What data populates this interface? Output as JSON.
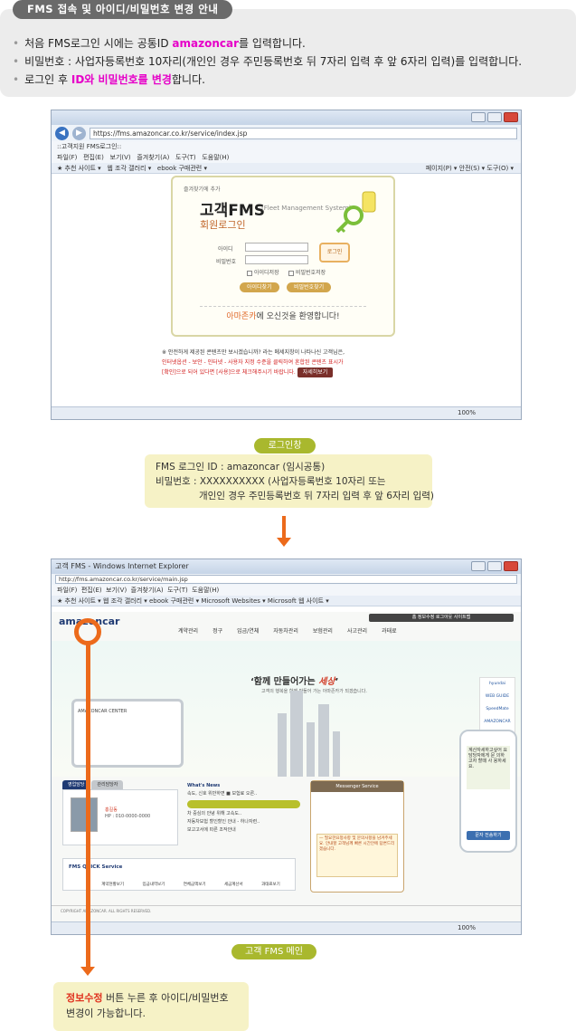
{
  "header": {
    "title": "FMS 접속 및 아이디/비밀번호 변경 안내",
    "bullets": [
      {
        "before": "처음 FMS로그인 시에는 공통ID ",
        "highlight": "amazoncar",
        "after": "를 입력합니다."
      },
      {
        "before": "비밀번호 : 사업자등록번호 10자리(개인인 경우 주민등록번호 뒤 7자리 입력 후 앞 6자리 입력)를 입력합니다.",
        "highlight": "",
        "after": ""
      },
      {
        "before": "로그인 후 ",
        "highlight": "ID와 비밀번호를 변경",
        "after": "합니다."
      }
    ]
  },
  "login_screen": {
    "url": "https://fms.amazoncar.co.kr/service/index.jsp",
    "tab_title": "::고객지원 FMS로그인::",
    "menu_items": [
      "파일(F)",
      "편집(E)",
      "보기(V)",
      "즐겨찾기(A)",
      "도구(T)",
      "도움말(H)"
    ],
    "fav_items": [
      "추천 사이트",
      "웹 조각 갤러리",
      "ebook 구매관련"
    ],
    "right_tools": "페이지(P) ▾  안전(S) ▾  도구(O) ▾",
    "card": {
      "fav": "즐겨찾기에 추가",
      "title": "고객FMS",
      "subtitle": "(Fleet Management System)",
      "login_label": "회원로그인",
      "id_label": "아이디",
      "pw_label": "비밀번호",
      "login_button": "로그인",
      "save_id": "아이디저장",
      "save_pw": "비밀번호저장",
      "find_id": "아이디찾기",
      "find_pw": "비밀번호찾기",
      "welcome_brand": "아마존카",
      "welcome_rest": "에 오신것을 환영합니다!"
    },
    "notice": {
      "line1": "※ 안전하게 제공된 콘텐츠만 보시겠습니까? 라는 메세지창이 나타나신 고객님은,",
      "line2": "인터넷옵션 - 보안 - 인터넷 - 사용자 지정 수준을 클릭하여 혼합된 콘텐츠 표시가",
      "line3": "[확인]으로 되어 있다면 [사용]으로 체크해주시기 바랍니다.",
      "detail_button": "자세히보기"
    },
    "zoom": "100%"
  },
  "login_label": "로그인창",
  "credentials": {
    "line1": "FMS 로그인 ID : amazoncar (임시공통)",
    "line2": "비밀번호 : XXXXXXXXXX (사업자등록번호 10자리 또는",
    "line3": "개인인 경우 주민등록번호 뒤 7자리 입력 후 앞 6자리 입력)"
  },
  "main_screen": {
    "title_bar": "고객 FMS - Windows Internet Explorer",
    "url": "http://fms.amazoncar.co.kr/service/main.jsp",
    "menu_items": [
      "파일(F)",
      "편집(E)",
      "보기(V)",
      "즐겨찾기(A)",
      "도구(T)",
      "도움말(H)"
    ],
    "fav_items": [
      "추천 사이트",
      "웹 조각 갤러리",
      "ebook 구매관련",
      "Microsoft Websites",
      "Microsoft 웹 사이트"
    ],
    "brand": "amazoncar",
    "top_links": "홈  정보수정  로그아웃  사이트맵",
    "nav": [
      "계약관리",
      "정구",
      "입금/연체",
      "자동차관리",
      "보험관리",
      "사고관리",
      "과태료"
    ],
    "slogan_a": "‘함께 만들어가는 ",
    "slogan_b": "세상",
    "slogan_c": "’",
    "slogan_sub": "고객의 행복을 함께 만들어 가는 아마존카가 되겠습니다.",
    "board_title": "AMAZONCAR CENTER",
    "side_logos": [
      "hyundai",
      "WEB GUIDE",
      "SpeedMate",
      "AMAZONCAR"
    ],
    "tabs": [
      "영업담당",
      "관리담당자"
    ],
    "profile_name": "홍길동",
    "profile_hp": "HP : 010-0000-0000",
    "news_title": "What's News",
    "news_line": "속도, 신호 위반하면 ■ 보험료 오른..",
    "news_items": [
      "차 중심의 안녕 위해 고속도..",
      "자동차보험 할인할인 안내 - 하나자련..",
      "보고고서에 따른 조작안내"
    ],
    "messenger_head": "Messenger Service",
    "messenger_text": "— 필요한요청사항 및 문의사항을 남겨주세요. 안내할 고객님께 빠른 시간안에 답변드리겠습니다.",
    "phone_text": "계산자세하고싶어 요 담당자에게 문 의하고자 할때 사 용하세요.",
    "phone_button": "문자 전송하기",
    "quick_title": "FMS QUICK Service",
    "quick_items": [
      "계약현황보기",
      "입금내역보기",
      "연체금액보기",
      "세금계산서",
      "과태료보기"
    ],
    "footer_text": "COPYRIGHT AMAZONCAR. ALL RIGHTS RESERVED.",
    "zoom": "100%"
  },
  "main_label": "고객 FMS 메인",
  "final_note": {
    "bold": "정보수정",
    "line1_rest": " 버튼 누른 후 아이디/비밀번호",
    "line2": "변경이 가능합니다."
  }
}
